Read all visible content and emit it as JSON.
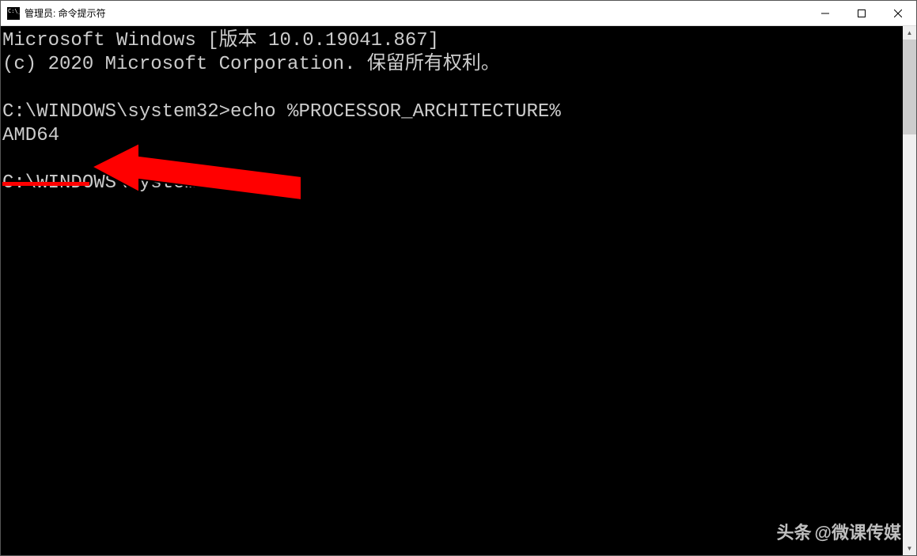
{
  "titlebar": {
    "title": "管理员: 命令提示符"
  },
  "console": {
    "line1": "Microsoft Windows [版本 10.0.19041.867]",
    "line2": "(c) 2020 Microsoft Corporation. 保留所有权利。",
    "blank1": "",
    "prompt1_path": "C:\\WINDOWS\\system32>",
    "prompt1_command": "echo %PROCESSOR_ARCHITECTURE%",
    "output1": "AMD64",
    "blank2": "",
    "prompt2_path": "C:\\WINDOWS\\system32>",
    "prompt2_command": ""
  },
  "watermark": {
    "logo": "头条",
    "text": "@微课传媒"
  }
}
